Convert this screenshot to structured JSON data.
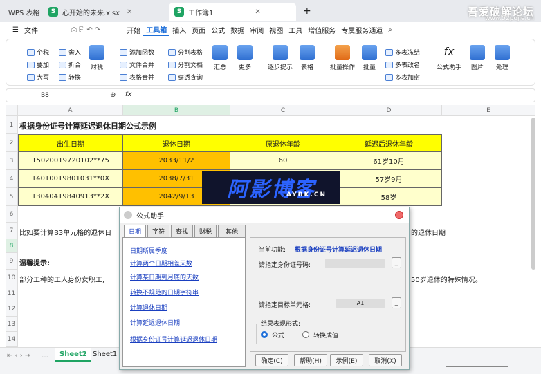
{
  "tabs": [
    {
      "label": "WPS 表格"
    },
    {
      "label": "心开始的未来.xlsx"
    },
    {
      "label": "工作簿1"
    }
  ],
  "watermark": {
    "title": "吾爱破解论坛",
    "url": "www.52pojie.cn"
  },
  "menu": [
    "文件",
    "开始",
    "工具箱",
    "插入",
    "页面",
    "公式",
    "数据",
    "审阅",
    "视图",
    "工具",
    "增值服务",
    "专属服务通道"
  ],
  "ribbon": {
    "small": [
      "个税",
      "要加",
      "大写",
      "舍入",
      "折合",
      "转换",
      "添加函数",
      "文件合并",
      "表格合并",
      "分割表格",
      "分割文档",
      "穿透查询",
      "多表冻结",
      "多表改名",
      "多表加密"
    ],
    "big": [
      "财税",
      "汇总",
      "更多",
      "逐步提示",
      "表格",
      "批量操作",
      "批量",
      "公式助手",
      "图片",
      "处理"
    ]
  },
  "formula_bar": {
    "cell": "B8",
    "fx": "fx"
  },
  "columns": [
    "A",
    "B",
    "C",
    "D",
    "E"
  ],
  "rows": [
    "1",
    "2",
    "3",
    "4",
    "5",
    "6",
    "7",
    "8",
    "9",
    "10",
    "11",
    "12",
    "13",
    "14",
    "15"
  ],
  "sheet": {
    "title": "根据身份证号计算延迟退休日期公式示例",
    "headers": [
      "出生日期",
      "退休日期",
      "原退休年龄",
      "延迟后退休年龄"
    ],
    "data": [
      [
        "15020019720102**75",
        "2033/11/2",
        "60",
        "61岁10月"
      ],
      [
        "14010019801031**0X",
        "2038/7/31",
        "",
        "57岁9月"
      ],
      [
        "13040419840913**2X",
        "2042/9/13",
        "",
        "58岁"
      ]
    ],
    "row7": "比如要计算B3单元格的退休日",
    "row7_right": "的退休日期",
    "row9": "温馨提示:",
    "row10": "部分工种的工人身份女职工,",
    "row10_right": "50岁退休的特殊情况。"
  },
  "logo_text": "阿影博客",
  "logo_sub": "AYBK.CN",
  "sheets": [
    "Sheet2",
    "Sheet1"
  ],
  "dialog": {
    "title": "公式助手",
    "tabs": [
      "日期",
      "字符",
      "查找",
      "财税",
      "其他"
    ],
    "links": [
      "日期所属季度",
      "计算两个日期相差天数",
      "计算某日期到月底的天数",
      "转换不规范的日期字符串",
      "计算退休日期",
      "计算延迟退休日期",
      "根据身份证号计算延迟退休日期"
    ],
    "current_label": "当前功能:",
    "current_value": "根据身份证号计算延迟退休日期",
    "id_label": "请指定身份证号码:",
    "target_label": "请指定目标单元格:",
    "target_value": "A1",
    "result_label": "结果表现形式:",
    "radio_formula": "公式",
    "radio_value": "转换成值",
    "buttons": [
      "确定(C)",
      "帮助(H)",
      "示例(E)",
      "取消(X)"
    ]
  }
}
